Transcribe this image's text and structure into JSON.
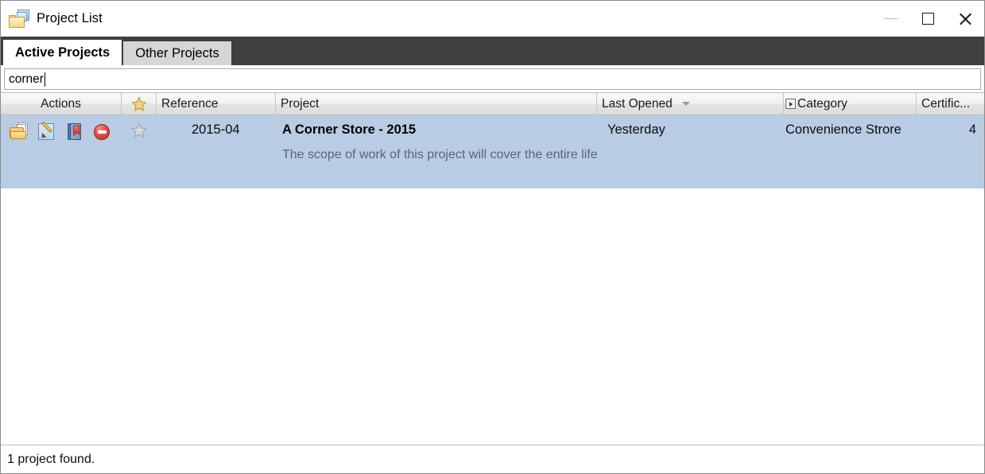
{
  "window": {
    "title": "Project List",
    "icon": "folder-documents-icon",
    "controls": {
      "minimize": "minimize-button",
      "maximize": "maximize-button",
      "close": "close-button"
    }
  },
  "tabs": [
    {
      "label": "Active Projects",
      "active": true
    },
    {
      "label": "Other Projects",
      "active": false
    }
  ],
  "search": {
    "value": "corner",
    "placeholder": ""
  },
  "grid": {
    "columns": [
      {
        "key": "actions",
        "label": "Actions"
      },
      {
        "key": "star",
        "label": "",
        "icon": "star-gold-icon"
      },
      {
        "key": "reference",
        "label": "Reference"
      },
      {
        "key": "project",
        "label": "Project"
      },
      {
        "key": "lastOpened",
        "label": "Last Opened",
        "sort": "desc"
      },
      {
        "key": "category",
        "label": "Category",
        "icon": "column-menu-icon"
      },
      {
        "key": "certific",
        "label": "Certific..."
      }
    ],
    "rows": [
      {
        "selected": true,
        "actions": [
          "open-folder-icon",
          "edit-pencil-icon",
          "book-icon",
          "block-icon"
        ],
        "star": "star-gray-icon",
        "reference": "2015-04",
        "project": {
          "title": "A Corner Store - 2015",
          "description": "The scope of work of this project will cover the entire life cycle of the project from land acquisition to store opening."
        },
        "lastOpened": "Yesterday",
        "category": "Convenience Strore",
        "certific": "4"
      }
    ]
  },
  "status": {
    "text": "1 project found."
  },
  "colors": {
    "selected_row": "#b8cce4",
    "tabstrip_bg": "#3f3f3f",
    "active_tab_bg": "#ffffff",
    "inactive_tab_bg": "#d6d6d6",
    "description_text": "#5b6670"
  }
}
